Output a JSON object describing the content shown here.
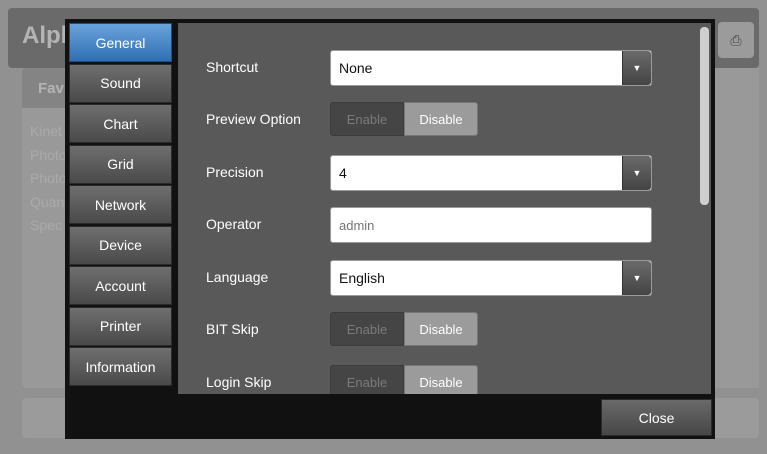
{
  "background": {
    "title": "Alph",
    "favorites_label": "Fav",
    "list_items": [
      "Kinet",
      "Photo",
      "Photo",
      "Quan",
      "Spec"
    ],
    "icon": "printer-icon"
  },
  "dialog": {
    "tabs": [
      {
        "label": "General",
        "active": true
      },
      {
        "label": "Sound",
        "active": false
      },
      {
        "label": "Chart",
        "active": false
      },
      {
        "label": "Grid",
        "active": false
      },
      {
        "label": "Network",
        "active": false
      },
      {
        "label": "Device",
        "active": false
      },
      {
        "label": "Account",
        "active": false
      },
      {
        "label": "Printer",
        "active": false
      },
      {
        "label": "Information",
        "active": false
      }
    ],
    "settings": {
      "shortcut": {
        "label": "Shortcut",
        "value": "None"
      },
      "preview_option": {
        "label": "Preview Option",
        "enable": "Enable",
        "disable": "Disable",
        "selected": "Disable"
      },
      "precision": {
        "label": "Precision",
        "value": "4"
      },
      "operator": {
        "label": "Operator",
        "placeholder": "admin"
      },
      "language": {
        "label": "Language",
        "value": "English"
      },
      "bit_skip": {
        "label": "BIT Skip",
        "enable": "Enable",
        "disable": "Disable",
        "selected": "Disable"
      },
      "login_skip": {
        "label": "Login Skip",
        "enable": "Enable",
        "disable": "Disable",
        "selected": "Disable"
      }
    },
    "close_label": "Close",
    "colors": {
      "active_tab": "#2f6fb2",
      "panel": "#595959",
      "frame": "#111111"
    }
  }
}
